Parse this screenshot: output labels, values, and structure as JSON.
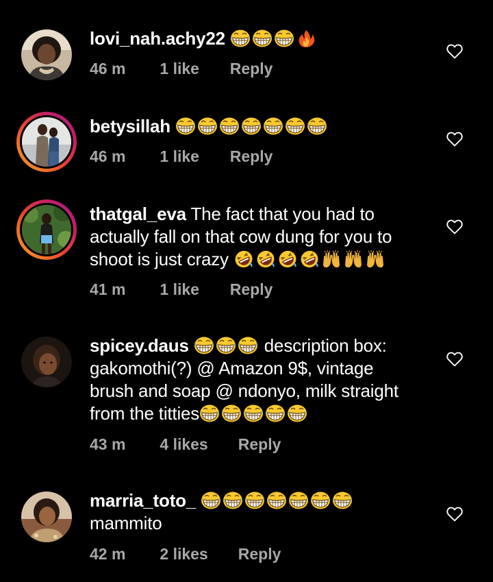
{
  "colors": {
    "background": "#000000",
    "text": "#ffffff",
    "meta_text": "#a8a8a8",
    "story_ring_start": "#f5a623",
    "story_ring_end": "#a01f85"
  },
  "comments": [
    {
      "username": "lovi_nah.achy22",
      "text": "",
      "emojis": [
        "grin-emoji",
        "grin-emoji",
        "grin-emoji",
        "fire-emoji"
      ],
      "time": "46 m",
      "likes": "1 like",
      "reply": "Reply",
      "has_story_ring": false
    },
    {
      "username": "betysillah",
      "text": "",
      "emojis": [
        "grin-emoji",
        "grin-emoji",
        "grin-emoji",
        "grin-emoji",
        "grin-emoji",
        "grin-emoji",
        "grin-emoji"
      ],
      "time": "46 m",
      "likes": "1 like",
      "reply": "Reply",
      "has_story_ring": true
    },
    {
      "username": "thatgal_eva",
      "text_line1": "The fact that you had to",
      "text_line2": "actually fall on that cow dung for you to",
      "text_line3": "shoot is just crazy",
      "emojis": [
        "rofl-emoji",
        "rofl-emoji",
        "rofl-emoji",
        "rofl-emoji",
        "raised-hands-emoji",
        "raised-hands-emoji",
        "raised-hands-emoji"
      ],
      "time": "41 m",
      "likes": "1 like",
      "reply": "Reply",
      "has_story_ring": true
    },
    {
      "username": "spicey.daus",
      "text_line1": "description box:",
      "text_line2": "gakomothi(?) @ Amazon 9$, vintage",
      "text_line3": "brush and soap @ ndonyo, milk straight",
      "text_line4": "from the titties",
      "emojis_after_name": [
        "grin-emoji",
        "grin-emoji",
        "grin-emoji"
      ],
      "emojis": [
        "grin-emoji",
        "grin-emoji",
        "grin-emoji",
        "grin-emoji",
        "grin-emoji"
      ],
      "time": "43 m",
      "likes": "4 likes",
      "reply": "Reply",
      "has_story_ring": false
    },
    {
      "username": "marria_toto_",
      "text_line2": "mammito",
      "emojis": [
        "grin-emoji",
        "grin-emoji",
        "grin-emoji",
        "grin-emoji",
        "grin-emoji",
        "grin-emoji",
        "grin-emoji"
      ],
      "time": "42 m",
      "likes": "2 likes",
      "reply": "Reply",
      "has_story_ring": false
    }
  ]
}
